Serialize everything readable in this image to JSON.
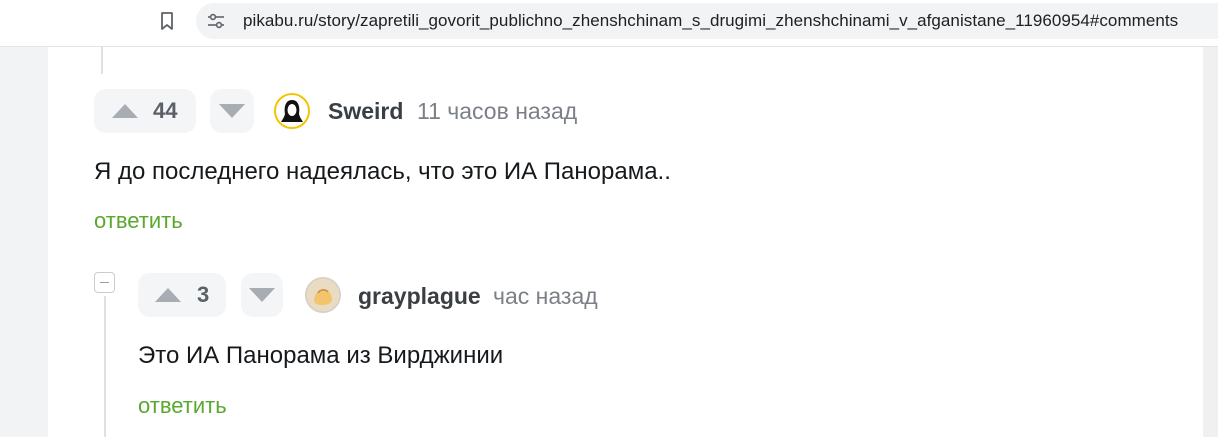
{
  "browser": {
    "url": "pikabu.ru/story/zapretili_govorit_publichno_zhenshchinam_s_drugimi_zhenshchinami_v_afganistane_11960954#comments",
    "icons": [
      "bookmark-icon",
      "site-info-icon"
    ]
  },
  "comments": [
    {
      "score": "44",
      "username": "Sweird",
      "time": "11 часов назад",
      "text": "Я до последнего надеялась, что это ИА Панорама..",
      "reply_label": "ответить"
    },
    {
      "score": "3",
      "username": "grayplague",
      "time": "час назад",
      "text": "Это ИА Панорама из Вирджинии",
      "reply_label": "ответить"
    }
  ],
  "colors": {
    "reply_link": "#5aa82f",
    "vote_box_bg": "#f4f5f7",
    "vote_arrow": "#a8adb3",
    "avatar_ring": "#f5c400"
  }
}
